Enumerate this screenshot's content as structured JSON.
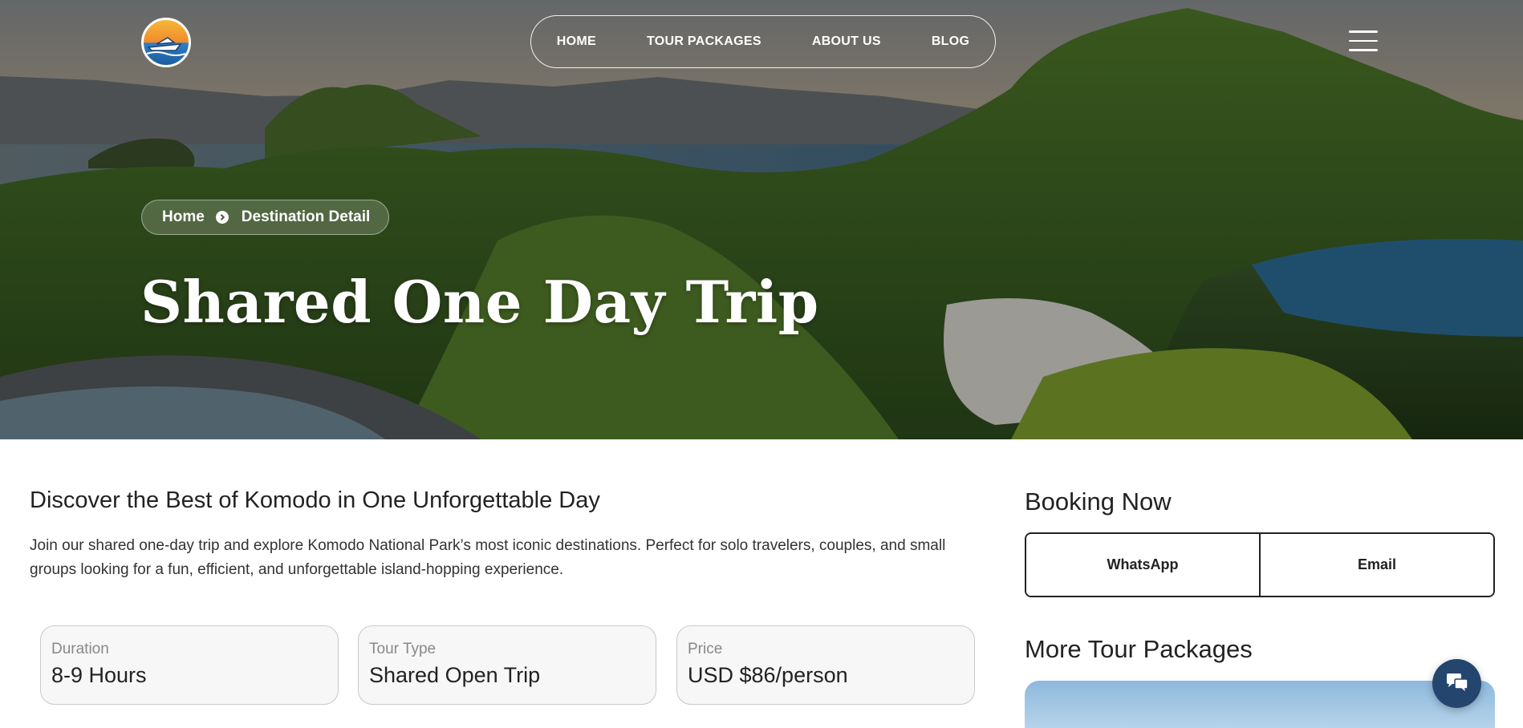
{
  "nav": {
    "items": [
      {
        "label": "HOME"
      },
      {
        "label": "TOUR PACKAGES"
      },
      {
        "label": "ABOUT US"
      },
      {
        "label": "BLOG"
      }
    ]
  },
  "hero": {
    "breadcrumb": {
      "home": "Home",
      "current": "Destination Detail"
    },
    "title": "Shared One Day Trip"
  },
  "main": {
    "heading": "Discover the Best of Komodo in One Unforgettable Day",
    "intro": "Join our shared one-day trip and explore Komodo National Park’s most iconic destinations. Perfect for solo travelers, couples, and small groups looking for a fun, efficient, and unforgettable island-hopping experience.",
    "info_cards": [
      {
        "label": "Duration",
        "value": "8-9 Hours"
      },
      {
        "label": "Tour Type",
        "value": "Shared Open Trip"
      },
      {
        "label": "Price",
        "value": "USD $86/person"
      }
    ]
  },
  "sidebar": {
    "booking_title": "Booking Now",
    "whatsapp_label": "WhatsApp",
    "email_label": "Email",
    "more_title": "More Tour Packages"
  },
  "icons": {
    "breadcrumb_separator": "chevron-right-circle-icon",
    "menu": "hamburger-menu-icon",
    "chat": "chat-bubbles-icon"
  },
  "colors": {
    "chat_button": "#24466e",
    "text_dark": "#222222"
  }
}
